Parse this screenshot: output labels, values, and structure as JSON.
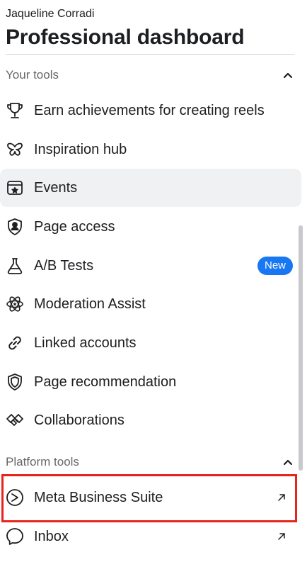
{
  "header": {
    "owner_name": "Jaqueline Corradi",
    "title": "Professional dashboard"
  },
  "your_tools": {
    "title": "Your tools",
    "items": [
      {
        "label": "Earn achievements for creating reels",
        "icon": "trophy-icon"
      },
      {
        "label": "Inspiration hub",
        "icon": "butterfly-icon"
      },
      {
        "label": "Events",
        "icon": "calendar-star-icon",
        "selected": true
      },
      {
        "label": "Page access",
        "icon": "shield-person-icon"
      },
      {
        "label": "A/B Tests",
        "icon": "flask-icon",
        "badge": "New"
      },
      {
        "label": "Moderation Assist",
        "icon": "atom-star-icon"
      },
      {
        "label": "Linked accounts",
        "icon": "link-icon"
      },
      {
        "label": "Page recommendation",
        "icon": "shield-icon"
      },
      {
        "label": "Collaborations",
        "icon": "handshake-icon"
      }
    ]
  },
  "platform_tools": {
    "title": "Platform tools",
    "items": [
      {
        "label": "Meta Business Suite",
        "icon": "business-suite-icon",
        "external": true,
        "highlighted": true
      },
      {
        "label": "Inbox",
        "icon": "messenger-icon",
        "external": true
      }
    ]
  },
  "colors": {
    "badge": "#1877f2",
    "highlight": "#e8231c",
    "selected_row": "#f0f1f2",
    "secondary_text": "#65676b"
  }
}
